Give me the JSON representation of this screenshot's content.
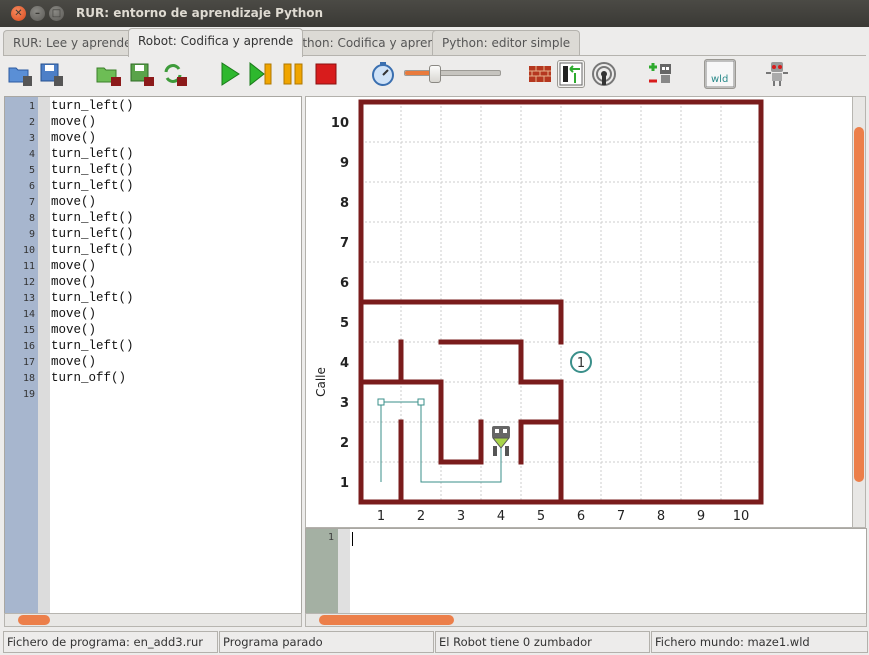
{
  "window": {
    "title": "RUR: entorno de aprendizaje Python"
  },
  "tabs": [
    {
      "label": "RUR: Lee y aprende",
      "active": false
    },
    {
      "label": "Robot: Codifica y aprende",
      "active": true
    },
    {
      "label": "Python: Codifica y aprende",
      "active": false
    },
    {
      "label": "Python: editor simple",
      "active": false
    }
  ],
  "toolbar": {
    "icons": [
      "open-program-icon",
      "save-program-icon",
      "open-world-icon",
      "save-world-icon",
      "reload-world-icon",
      "run-icon",
      "step-icon",
      "pause-icon",
      "stop-icon",
      "speed-timer-icon",
      "wall-icon",
      "resize-world-icon",
      "beeper-icon",
      "add-robot-icon",
      "world-file-icon",
      "robot-settings-icon"
    ],
    "speed_level": 0.3,
    "world_file_label": "wld"
  },
  "editor": {
    "lines": [
      "turn_left()",
      "move()",
      "move()",
      "turn_left()",
      "turn_left()",
      "turn_left()",
      "move()",
      "turn_left()",
      "turn_left()",
      "turn_left()",
      "move()",
      "move()",
      "turn_left()",
      "move()",
      "move()",
      "turn_left()",
      "move()",
      "turn_off()",
      ""
    ]
  },
  "world": {
    "avenues": 10,
    "streets": 10,
    "x_tick_labels": [
      "1",
      "2",
      "3",
      "4",
      "5",
      "6",
      "7",
      "8",
      "9",
      "10"
    ],
    "y_tick_labels": [
      "1",
      "2",
      "3",
      "4",
      "5",
      "6",
      "7",
      "8",
      "9",
      "10"
    ],
    "y_axis_label": "Calle",
    "beeper": {
      "avenue": 6,
      "street": 4,
      "count": "1"
    },
    "robot": {
      "avenue": 4,
      "street": 2
    },
    "colors": {
      "wall": "#7a1c1c",
      "trace": "#3a8f8a",
      "beeper": "#3a8f8a",
      "grid": "#cccccc"
    }
  },
  "console": {
    "line_number": "1"
  },
  "status": {
    "program_file": "Fichero de programa: en_add3.rur",
    "program_state": "Programa parado",
    "beepers": "El Robot tiene 0 zumbador",
    "world_file": "Fichero mundo: maze1.wld"
  }
}
